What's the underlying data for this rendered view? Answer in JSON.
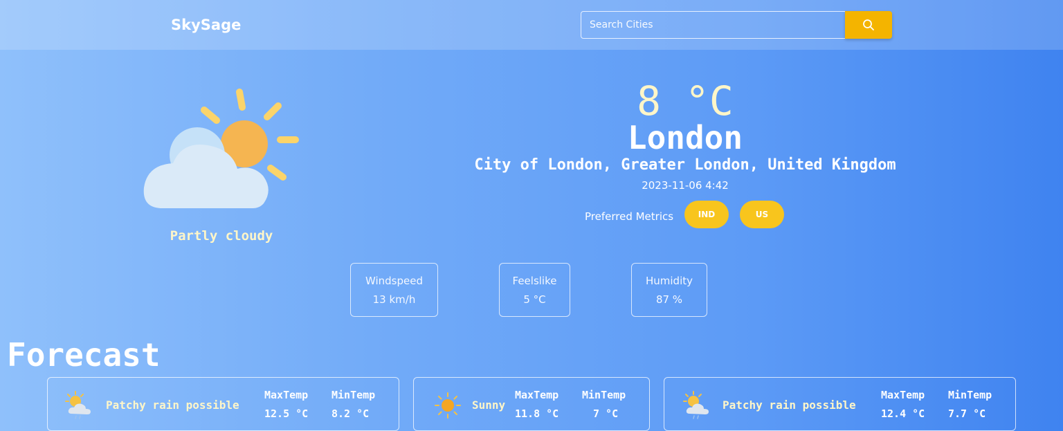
{
  "app": {
    "brand": "SkySage"
  },
  "search": {
    "placeholder": "Search Cities",
    "icon": "search-icon"
  },
  "current": {
    "temperature": "8 °C",
    "city": "London",
    "region": "City of London, Greater London, United Kingdom",
    "localtime": "2023-11-06 4:42",
    "condition": "Partly cloudy",
    "condition_icon": "partly-cloudy-icon"
  },
  "metrics": {
    "label": "Preferred Metrics",
    "options": [
      "IND",
      "US"
    ]
  },
  "stats": [
    {
      "label": "Windspeed",
      "value": "13 km/h"
    },
    {
      "label": "Feelslike",
      "value": "5 °C"
    },
    {
      "label": "Humidity",
      "value": "87 %"
    }
  ],
  "forecast": {
    "title": "Forecast",
    "days": [
      {
        "condition": "Patchy rain possible",
        "icon": "patchy-rain-icon",
        "max_label": "MaxTemp",
        "max": "12.5 °C",
        "min_label": "MinTemp",
        "min": "8.2 °C"
      },
      {
        "condition": "Sunny",
        "icon": "sun-icon",
        "max_label": "MaxTemp",
        "max": "11.8 °C",
        "min_label": "MinTemp",
        "min": "7 °C"
      },
      {
        "condition": "Patchy rain possible",
        "icon": "patchy-rain-icon",
        "max_label": "MaxTemp",
        "max": "12.4 °C",
        "min_label": "MinTemp",
        "min": "7.7 °C"
      }
    ]
  },
  "colors": {
    "accent": "#f4b400",
    "button": "#f8c51d",
    "highlight_text": "#fff6c8"
  }
}
